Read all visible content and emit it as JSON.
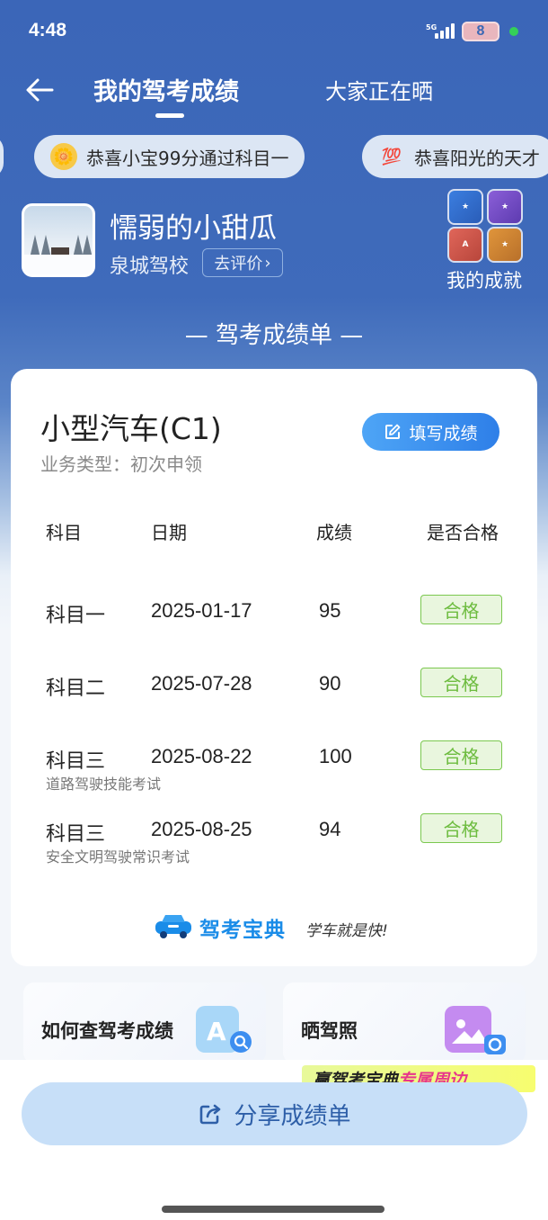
{
  "status": {
    "time": "4:48",
    "network": "5G",
    "battery": "8"
  },
  "nav": {
    "active_tab": "我的驾考成绩",
    "other_tab": "大家正在晒"
  },
  "ticker": [
    {
      "icon": "🌼",
      "text": "恭喜小宝99分通过科目一"
    },
    {
      "icon": "💯",
      "text": "恭喜阳光的天才"
    }
  ],
  "profile": {
    "name": "懦弱的小甜瓜",
    "school": "泉城驾校",
    "rate_label": "去评价",
    "achievements_label": "我的成就"
  },
  "section_title": "— 驾考成绩单 —",
  "card": {
    "vehicle": "小型汽车(C1)",
    "business_type": "业务类型：初次申领",
    "fill_button": "填写成绩",
    "headers": {
      "subject": "科目",
      "date": "日期",
      "score": "成绩",
      "passed": "是否合格"
    },
    "rows": [
      {
        "subject": "科目一",
        "date": "2025-01-17",
        "score": "95",
        "status": "合格",
        "desc": ""
      },
      {
        "subject": "科目二",
        "date": "2025-07-28",
        "score": "90",
        "status": "合格",
        "desc": ""
      },
      {
        "subject": "科目三",
        "date": "2025-08-22",
        "score": "100",
        "status": "合格",
        "desc": "道路驾驶技能考试"
      },
      {
        "subject": "科目三",
        "date": "2025-08-25",
        "score": "94",
        "status": "合格",
        "desc": "安全文明驾驶常识考试"
      }
    ],
    "brand_name": "驾考宝典",
    "brand_slogan": "学车就是快!"
  },
  "tiles": [
    {
      "label": "如何查驾考成绩"
    },
    {
      "label": "晒驾照"
    }
  ],
  "promo": {
    "prefix": "赢驾考宝典",
    "accent": "专属周边"
  },
  "share_button": "分享成绩单",
  "colors": {
    "primary_blue": "#3b66b8",
    "pass_green": "#6dbc3f",
    "button_blue": "#2e7fe8"
  }
}
